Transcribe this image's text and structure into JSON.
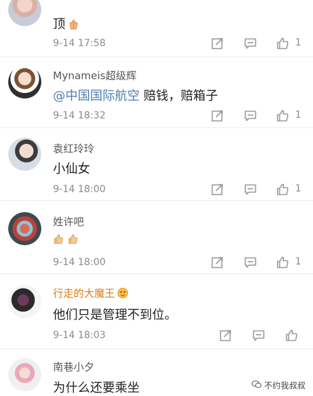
{
  "comments": [
    {
      "username": "",
      "text": "顶",
      "emoji": "hands-together-emoji",
      "time": "9-14 17:58",
      "likes": "1"
    },
    {
      "username": "Mynameis超级辉",
      "mention": "@中国国际航空",
      "text": " 赔钱，赔箱子",
      "time": "9-14 18:32",
      "likes": "1"
    },
    {
      "username": "袁红玲玲",
      "text": "小仙女",
      "time": "9-14 18:00",
      "likes": "1"
    },
    {
      "username": "姓许吧",
      "text": "",
      "emoji": "thumbs-up-emoji x2",
      "time": "9-14 18:00",
      "likes": "1"
    },
    {
      "username": "行走的大魔王",
      "badge": "heart-eyes-emoji",
      "text": "他们只是管理不到位。",
      "time": "9-14 18:03",
      "likes": ""
    },
    {
      "username": "南巷小夕",
      "text": "为什么还要乘坐"
    }
  ],
  "watermark": "不约我叔叔",
  "colors": {
    "accent_name": "#e07a16",
    "mention": "#507daf",
    "icon": "#9a9a9a"
  },
  "icons": [
    "share-icon",
    "comment-icon",
    "like-icon"
  ]
}
